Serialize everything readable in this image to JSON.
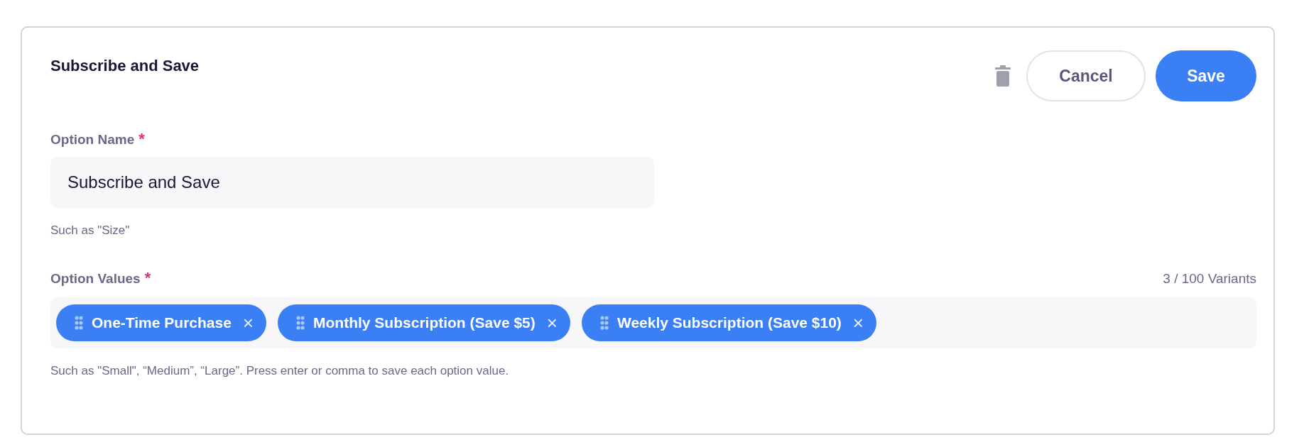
{
  "card": {
    "title": "Subscribe and Save"
  },
  "actions": {
    "cancel": "Cancel",
    "save": "Save"
  },
  "option_name": {
    "label": "Option Name",
    "required_mark": "*",
    "value": "Subscribe and Save",
    "hint": "Such as \"Size\""
  },
  "option_values": {
    "label": "Option Values",
    "required_mark": "*",
    "counter": "3 / 100 Variants",
    "tags": [
      {
        "label": "One-Time Purchase",
        "remove": "×"
      },
      {
        "label": "Monthly Subscription (Save $5)",
        "remove": "×"
      },
      {
        "label": "Weekly Subscription (Save $10)",
        "remove": "×"
      }
    ],
    "hint": "Such as \"Small\", “Medium”, “Large”. Press enter or comma to save each option value."
  }
}
